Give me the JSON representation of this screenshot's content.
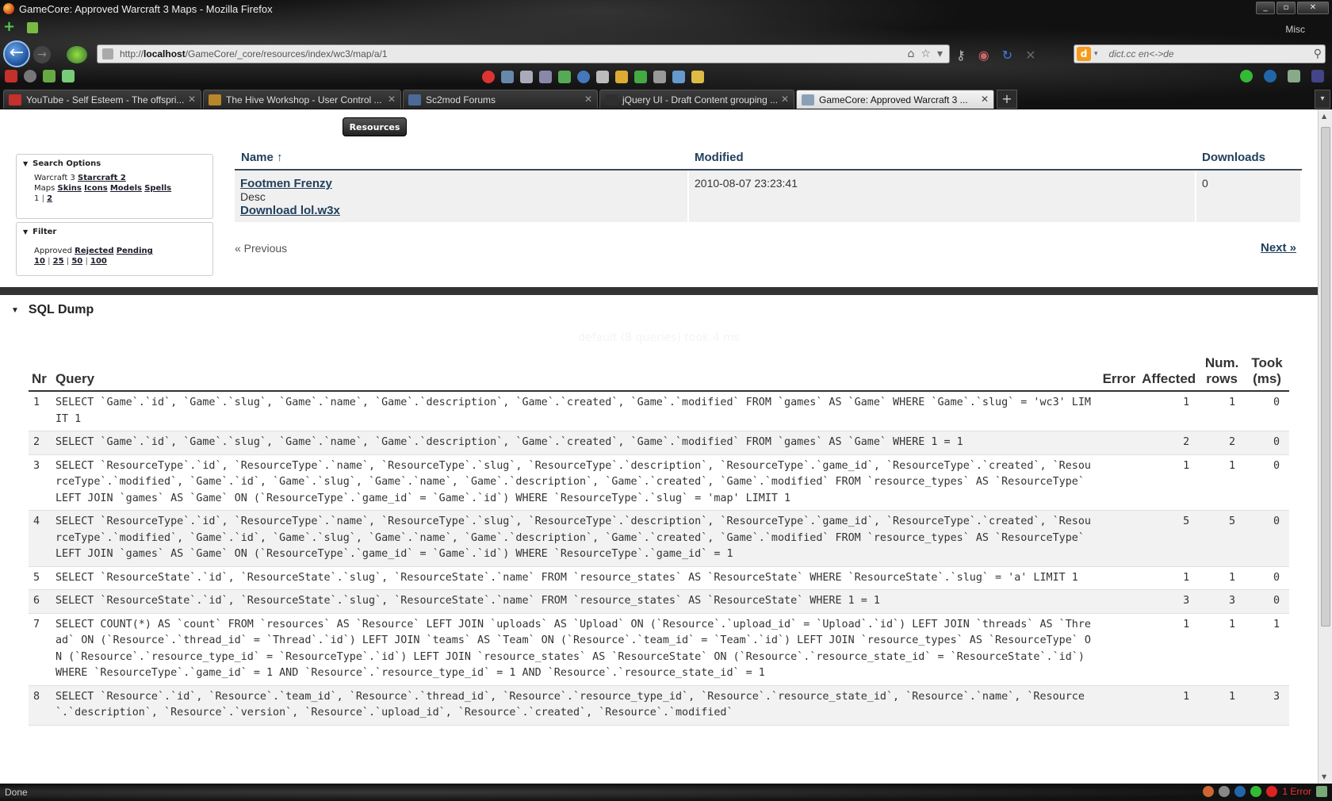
{
  "window": {
    "title": "GameCore: Approved Warcraft 3 Maps - Mozilla Firefox",
    "controls": [
      "_",
      "▫",
      "✕"
    ]
  },
  "toolbar": {
    "misc_label": "Misc"
  },
  "navigation": {
    "url_prefix": "http://",
    "url_host": "localhost",
    "url_path": "/GameCore/_core/resources/index/wc3/map/a/1",
    "search_placeholder": "dict.cc en<->de"
  },
  "tabs": [
    {
      "label": "YouTube - Self Esteem - The offspri...",
      "icon_color": "#c4302b"
    },
    {
      "label": "The Hive Workshop - User Control ...",
      "icon_color": "#b8862b"
    },
    {
      "label": "Sc2mod Forums",
      "icon_color": "#4a6a9a"
    },
    {
      "label": "jQuery UI - Draft Content grouping ...",
      "icon_color": "#2f2f2f"
    },
    {
      "label": "GameCore: Approved Warcraft 3 ...",
      "icon_color": "#8aa0b8",
      "active": true
    }
  ],
  "new_tab_label": "+",
  "page": {
    "resources_button": "Resources",
    "search_options": {
      "title": "Search Options",
      "game_current": "Warcraft 3",
      "game_link": "Starcraft 2",
      "type_current": "Maps",
      "type_links": [
        "Skins",
        "Icons",
        "Models",
        "Spells"
      ],
      "page_current": "1",
      "page_link": "2"
    },
    "filter": {
      "title": "Filter",
      "state_current": "Approved",
      "state_links": [
        "Rejected",
        "Pending"
      ],
      "limits": [
        "10",
        "25",
        "50",
        "100"
      ]
    },
    "table": {
      "headers": {
        "name": "Name ↑",
        "modified": "Modified",
        "downloads": "Downloads"
      },
      "rows": [
        {
          "name": "Footmen Frenzy",
          "desc": "Desc",
          "download": "Download lol.w3x",
          "modified": "2010-08-07 23:23:41",
          "downloads": "0"
        }
      ]
    },
    "pager": {
      "previous": "« Previous",
      "next": "Next »"
    }
  },
  "sql_dump": {
    "title": "SQL Dump",
    "caption": "default (8 queries) took 4 ms",
    "headers": {
      "nr": "Nr",
      "query": "Query",
      "error": "Error",
      "affected": "Affected",
      "num_rows": "Num. rows",
      "took": "Took (ms)"
    },
    "rows": [
      {
        "nr": "1",
        "query": "SELECT `Game`.`id`, `Game`.`slug`, `Game`.`name`, `Game`.`description`, `Game`.`created`, `Game`.`modified` FROM `games` AS `Game` WHERE `Game`.`slug` = 'wc3' LIMIT 1",
        "error": "",
        "affected": "1",
        "num_rows": "1",
        "took": "0"
      },
      {
        "nr": "2",
        "query": "SELECT `Game`.`id`, `Game`.`slug`, `Game`.`name`, `Game`.`description`, `Game`.`created`, `Game`.`modified` FROM `games` AS `Game` WHERE 1 = 1",
        "error": "",
        "affected": "2",
        "num_rows": "2",
        "took": "0"
      },
      {
        "nr": "3",
        "query": "SELECT `ResourceType`.`id`, `ResourceType`.`name`, `ResourceType`.`slug`, `ResourceType`.`description`, `ResourceType`.`game_id`, `ResourceType`.`created`, `ResourceType`.`modified`, `Game`.`id`, `Game`.`slug`, `Game`.`name`, `Game`.`description`, `Game`.`created`, `Game`.`modified` FROM `resource_types` AS `ResourceType` LEFT JOIN `games` AS `Game` ON (`ResourceType`.`game_id` = `Game`.`id`) WHERE `ResourceType`.`slug` = 'map' LIMIT 1",
        "error": "",
        "affected": "1",
        "num_rows": "1",
        "took": "0"
      },
      {
        "nr": "4",
        "query": "SELECT `ResourceType`.`id`, `ResourceType`.`name`, `ResourceType`.`slug`, `ResourceType`.`description`, `ResourceType`.`game_id`, `ResourceType`.`created`, `ResourceType`.`modified`, `Game`.`id`, `Game`.`slug`, `Game`.`name`, `Game`.`description`, `Game`.`created`, `Game`.`modified` FROM `resource_types` AS `ResourceType` LEFT JOIN `games` AS `Game` ON (`ResourceType`.`game_id` = `Game`.`id`) WHERE `ResourceType`.`game_id` = 1",
        "error": "",
        "affected": "5",
        "num_rows": "5",
        "took": "0"
      },
      {
        "nr": "5",
        "query": "SELECT `ResourceState`.`id`, `ResourceState`.`slug`, `ResourceState`.`name` FROM `resource_states` AS `ResourceState` WHERE `ResourceState`.`slug` = 'a' LIMIT 1",
        "error": "",
        "affected": "1",
        "num_rows": "1",
        "took": "0"
      },
      {
        "nr": "6",
        "query": "SELECT `ResourceState`.`id`, `ResourceState`.`slug`, `ResourceState`.`name` FROM `resource_states` AS `ResourceState` WHERE 1 = 1",
        "error": "",
        "affected": "3",
        "num_rows": "3",
        "took": "0"
      },
      {
        "nr": "7",
        "query": "SELECT COUNT(*) AS `count` FROM `resources` AS `Resource` LEFT JOIN `uploads` AS `Upload` ON (`Resource`.`upload_id` = `Upload`.`id`) LEFT JOIN `threads` AS `Thread` ON (`Resource`.`thread_id` = `Thread`.`id`) LEFT JOIN `teams` AS `Team` ON (`Resource`.`team_id` = `Team`.`id`) LEFT JOIN `resource_types` AS `ResourceType` ON (`Resource`.`resource_type_id` = `ResourceType`.`id`) LEFT JOIN `resource_states` AS `ResourceState` ON (`Resource`.`resource_state_id` = `ResourceState`.`id`) WHERE `ResourceType`.`game_id` = 1 AND `Resource`.`resource_type_id` = 1 AND `Resource`.`resource_state_id` = 1",
        "error": "",
        "affected": "1",
        "num_rows": "1",
        "took": "1"
      },
      {
        "nr": "8",
        "query": "SELECT `Resource`.`id`, `Resource`.`team_id`, `Resource`.`thread_id`, `Resource`.`resource_type_id`, `Resource`.`resource_state_id`, `Resource`.`name`, `Resource`.`description`, `Resource`.`version`, `Resource`.`upload_id`, `Resource`.`created`, `Resource`.`modified`",
        "error": "",
        "affected": "1",
        "num_rows": "1",
        "took": "3"
      }
    ]
  },
  "status": {
    "text": "Done",
    "error_text": "1 Error"
  }
}
